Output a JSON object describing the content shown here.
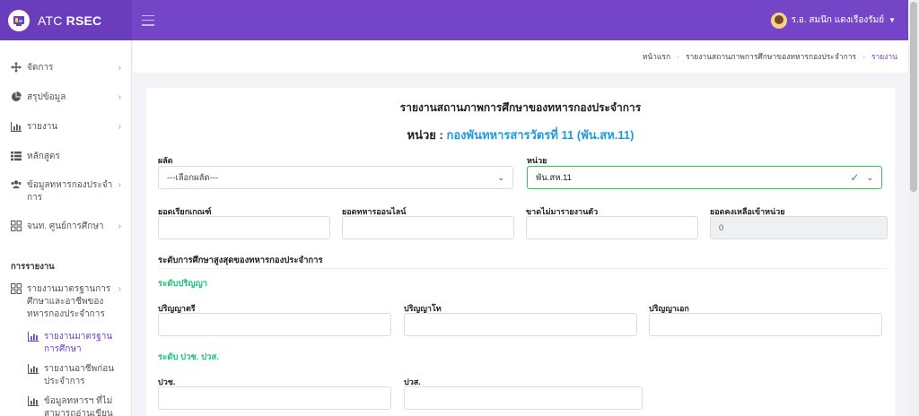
{
  "app": {
    "brand_prefix": "ATC",
    "brand_bold": "RSEC",
    "user_name": "ร.อ. สมนึก แดงเรืองรัมย์"
  },
  "sidebar": {
    "items": [
      {
        "label": "จัดการ",
        "icon": "move-icon"
      },
      {
        "label": "สรุปข้อมูล",
        "icon": "pie-chart-icon"
      },
      {
        "label": "รายงาน",
        "icon": "bar-chart-icon"
      },
      {
        "label": "หลักสูตร",
        "icon": "list-icon"
      },
      {
        "label": "ข้อมูลทหารกองประจำการ",
        "icon": "users-icon"
      },
      {
        "label": "จนท. ศูนย์การศึกษา",
        "icon": "grid-icon"
      }
    ],
    "section_title": "การรายงาน",
    "report_group": {
      "label": "รายงานมาตรฐานการศึกษาและอาชีพของทหารกองประจำการ",
      "icon": "grid-icon"
    },
    "sub_items": [
      {
        "label": "รายงานมาตรฐานการศึกษา",
        "icon": "bar-chart-icon"
      },
      {
        "label": "รายงานอาชีพก่อนประจำการ",
        "icon": "bar-chart-icon"
      },
      {
        "label": "ข้อมูลทหารฯ ที่ไม่สามารถอ่านเขียนภาษา",
        "icon": "bar-chart-icon"
      }
    ]
  },
  "breadcrumb": {
    "home": "หน้าแรก",
    "parent": "รายงานสถานภาพการศึกษาของทหารกองประจำการ",
    "current": "รายงาน"
  },
  "report": {
    "title": "รายงานสถานภาพการศึกษาของทหารกองประจำการ",
    "unit_label": "หน่วย : ",
    "unit_value": "กองพันทหารสารวัตรที่ 11 (พัน.สห.11)"
  },
  "form": {
    "batch_label": "ผลัด",
    "batch_value": "---เลือกผลัด---",
    "unit_label": "หน่วย",
    "unit_value": "พัน.สห.11",
    "called_label": "ยอดเรียกเกณฑ์",
    "online_label": "ยอดทหารออนไลน์",
    "missing_label": "ขาดไม่มารายงานตัว",
    "remaining_label": "ยอดคงเหลือเข้าหน่วย",
    "remaining_value": "0",
    "edu_section": "ระดับการศึกษาสูงสุดของทหารกองประจำการ",
    "degree_head": "ระดับปริญญา",
    "bachelor_label": "ปริญญาตรี",
    "master_label": "ปริญญาโท",
    "doctor_label": "ปริญญาเอก",
    "voc_head": "ระดับ ปวช. ปวส.",
    "pvc_label": "ปวช.",
    "pvs_label": "ปวส."
  }
}
